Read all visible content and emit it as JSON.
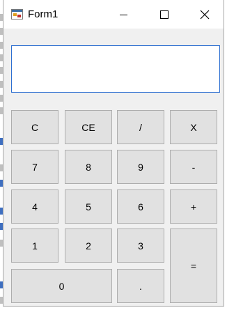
{
  "window": {
    "title": "Form1",
    "icons": {
      "app": "form-app-icon",
      "minimize": "minimize-icon",
      "maximize": "maximize-icon",
      "close": "close-icon"
    }
  },
  "display": {
    "value": ""
  },
  "buttons": {
    "clear": "C",
    "clear_entry": "CE",
    "divide": "/",
    "multiply": "X",
    "seven": "7",
    "eight": "8",
    "nine": "9",
    "minus": "-",
    "four": "4",
    "five": "5",
    "six": "6",
    "plus": "+",
    "one": "1",
    "two": "2",
    "three": "3",
    "equals": "=",
    "zero": "0",
    "decimal": "."
  },
  "colors": {
    "display_border": "#2d6fd1",
    "button_face": "#e1e1e1",
    "window_face": "#f0f0f0"
  }
}
